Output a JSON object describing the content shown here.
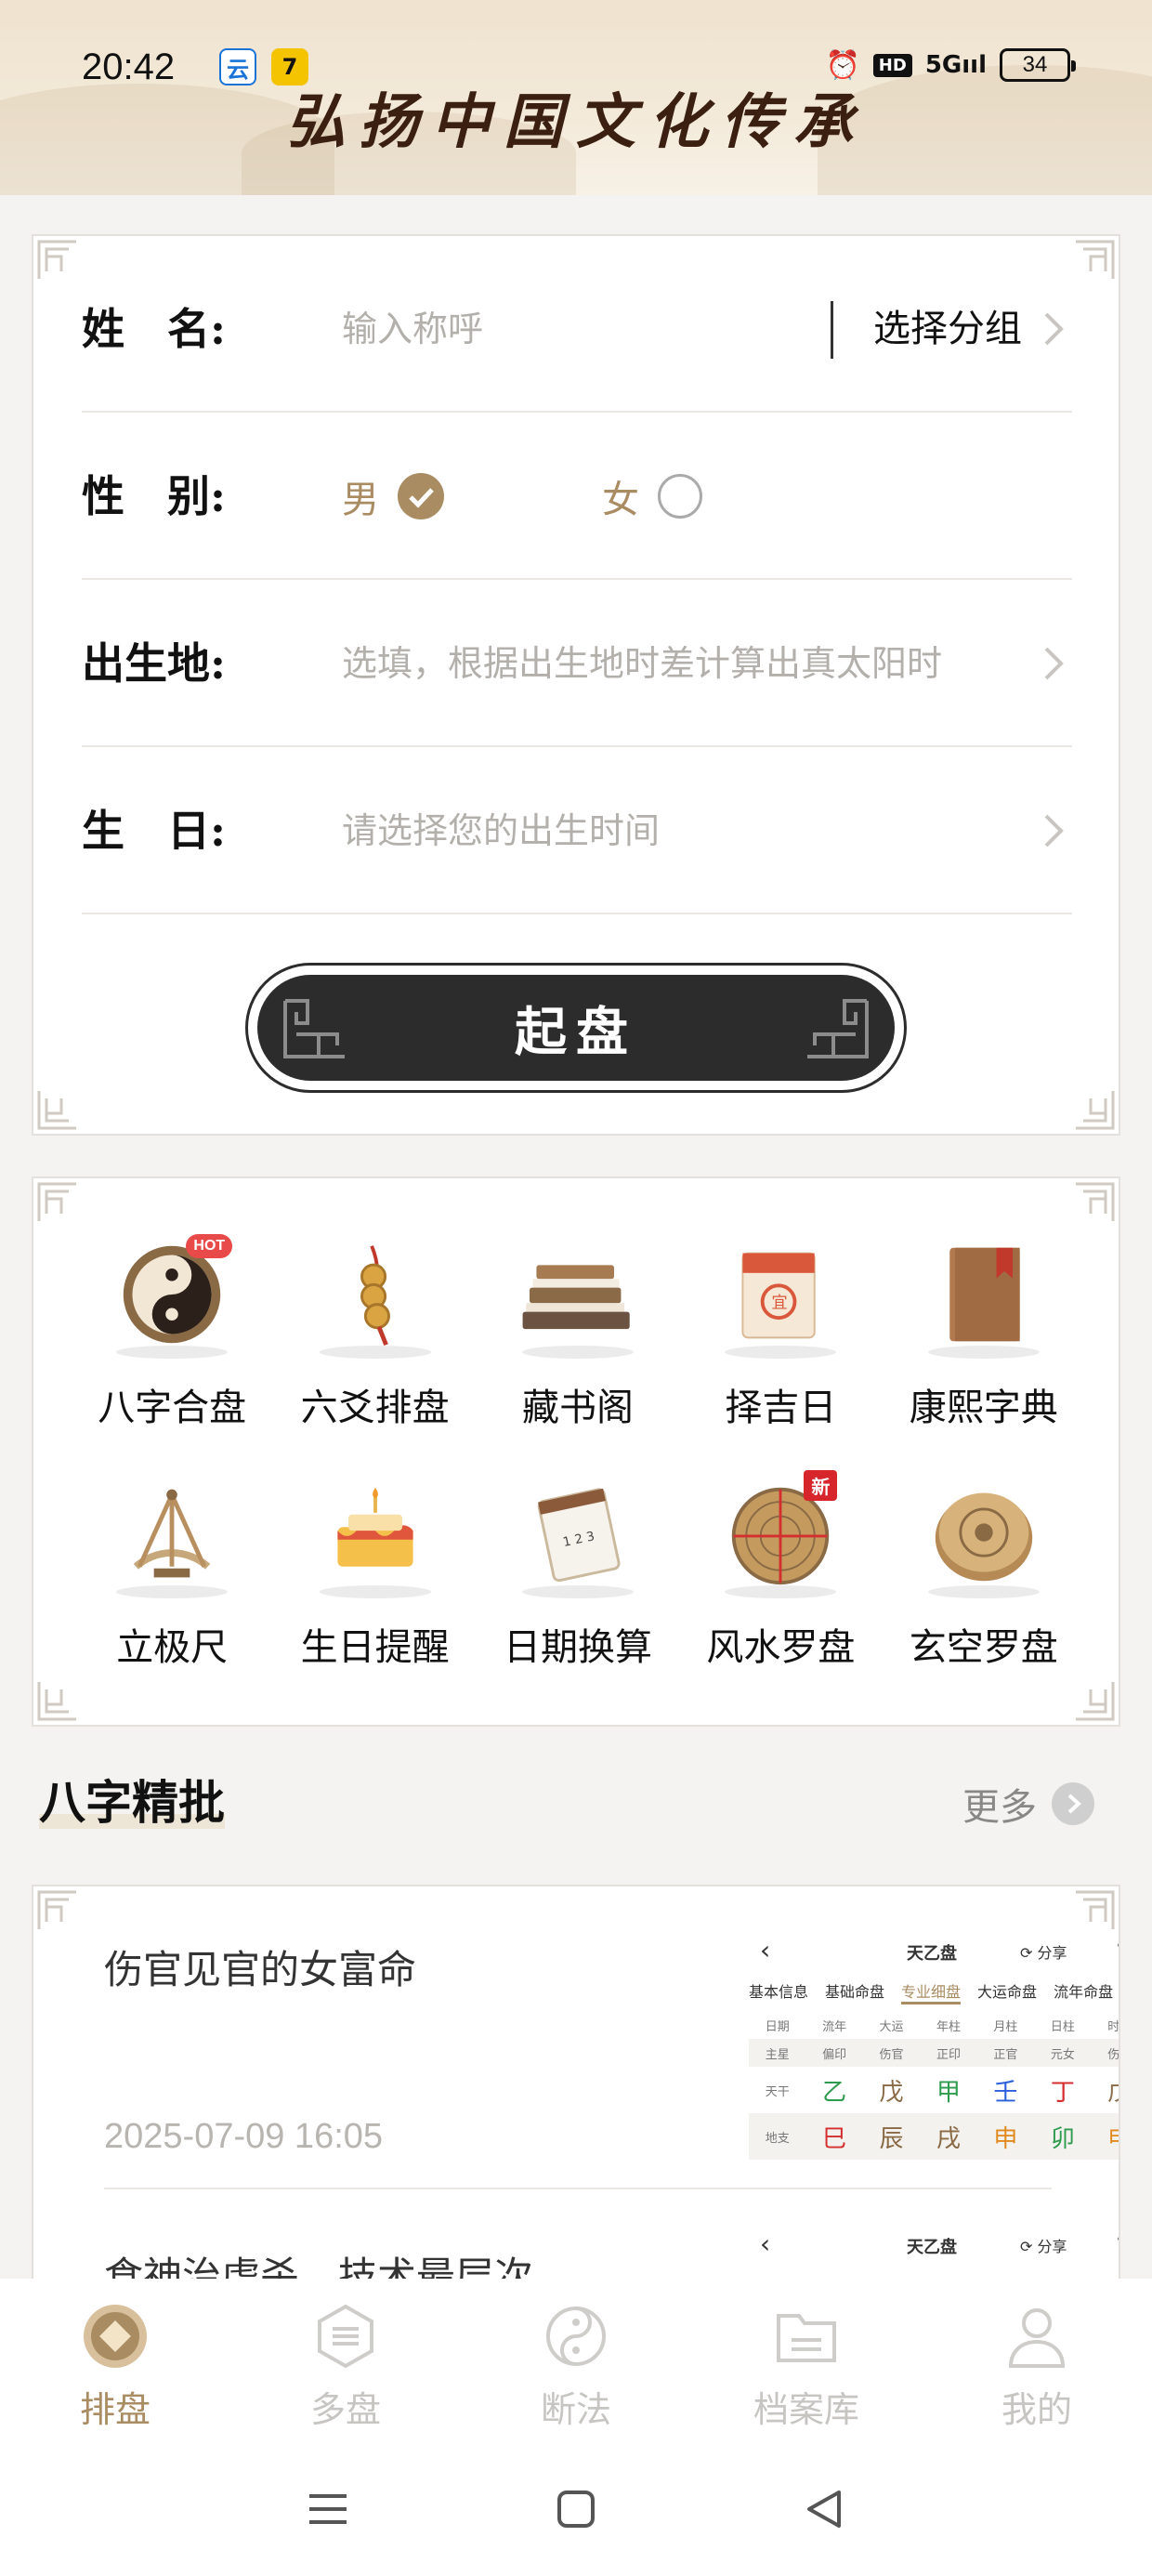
{
  "status_bar": {
    "time": "20:42",
    "battery": "34",
    "network": "5G"
  },
  "banner": {
    "title": "弘扬中国文化传承"
  },
  "form": {
    "name_label": "姓　名:",
    "name_placeholder": "输入称呼",
    "group_select": "选择分组",
    "gender_label": "性　别:",
    "gender_male": "男",
    "gender_female": "女",
    "gender_selected": "男",
    "birthplace_label": "出生地:",
    "birthplace_placeholder": "选填，根据出生地时差计算出真太阳时",
    "birthday_label": "生　日:",
    "birthday_placeholder": "请选择您的出生时间",
    "submit_label": "起盘"
  },
  "tools": [
    {
      "label": "八字合盘",
      "icon": "yin-yang-icon",
      "badge": "HOT"
    },
    {
      "label": "六爻排盘",
      "icon": "coins-icon",
      "badge": ""
    },
    {
      "label": "藏书阁",
      "icon": "books-icon",
      "badge": ""
    },
    {
      "label": "择吉日",
      "icon": "calendar-icon",
      "badge": ""
    },
    {
      "label": "康熙字典",
      "icon": "dictionary-icon",
      "badge": ""
    },
    {
      "label": "立极尺",
      "icon": "sextant-icon",
      "badge": ""
    },
    {
      "label": "生日提醒",
      "icon": "cake-icon",
      "badge": ""
    },
    {
      "label": "日期换算",
      "icon": "date-calendar-icon",
      "badge": ""
    },
    {
      "label": "风水罗盘",
      "icon": "compass-icon",
      "badge": "新"
    },
    {
      "label": "玄空罗盘",
      "icon": "xuankong-compass-icon",
      "badge": ""
    }
  ],
  "section": {
    "title": "八字精批",
    "more": "更多"
  },
  "articles": [
    {
      "title": "伤官见官的女富命",
      "date": "2025-07-09 16:05",
      "thumb": {
        "title": "天乙盘",
        "share": "分享",
        "tabs": [
          "基本信息",
          "基础命盘",
          "专业细盘",
          "大运命盘",
          "流年命盘"
        ],
        "active_tab": "专业细盘",
        "row_head": [
          "日期",
          "流年",
          "大运",
          "年柱",
          "月柱",
          "日柱",
          "时柱"
        ],
        "row_zhuxing": [
          "主星",
          "偏印",
          "伤官",
          "正印",
          "正官",
          "元女",
          "伤官"
        ],
        "row_tiangan": [
          "天干",
          "乙",
          "戊",
          "甲",
          "壬",
          "丁",
          "戊"
        ],
        "row_dizhi": [
          "地支",
          "巳",
          "辰",
          "戌",
          "申",
          "卯",
          "申"
        ]
      }
    },
    {
      "title": "食神治虐杀，技术最层次",
      "date": "",
      "thumb": {
        "title": "天乙盘",
        "share": "分享"
      }
    }
  ],
  "tabbar": [
    {
      "label": "排盘",
      "icon": "paipan-icon",
      "active": true
    },
    {
      "label": "多盘",
      "icon": "duopan-icon",
      "active": false
    },
    {
      "label": "断法",
      "icon": "taiji-icon",
      "active": false
    },
    {
      "label": "档案库",
      "icon": "folder-icon",
      "active": false
    },
    {
      "label": "我的",
      "icon": "profile-icon",
      "active": false
    }
  ],
  "colors": {
    "accent": "#a98c62",
    "dark_button": "#2c2c2c",
    "placeholder": "#b3b0ab",
    "background": "#f4f3f1"
  }
}
